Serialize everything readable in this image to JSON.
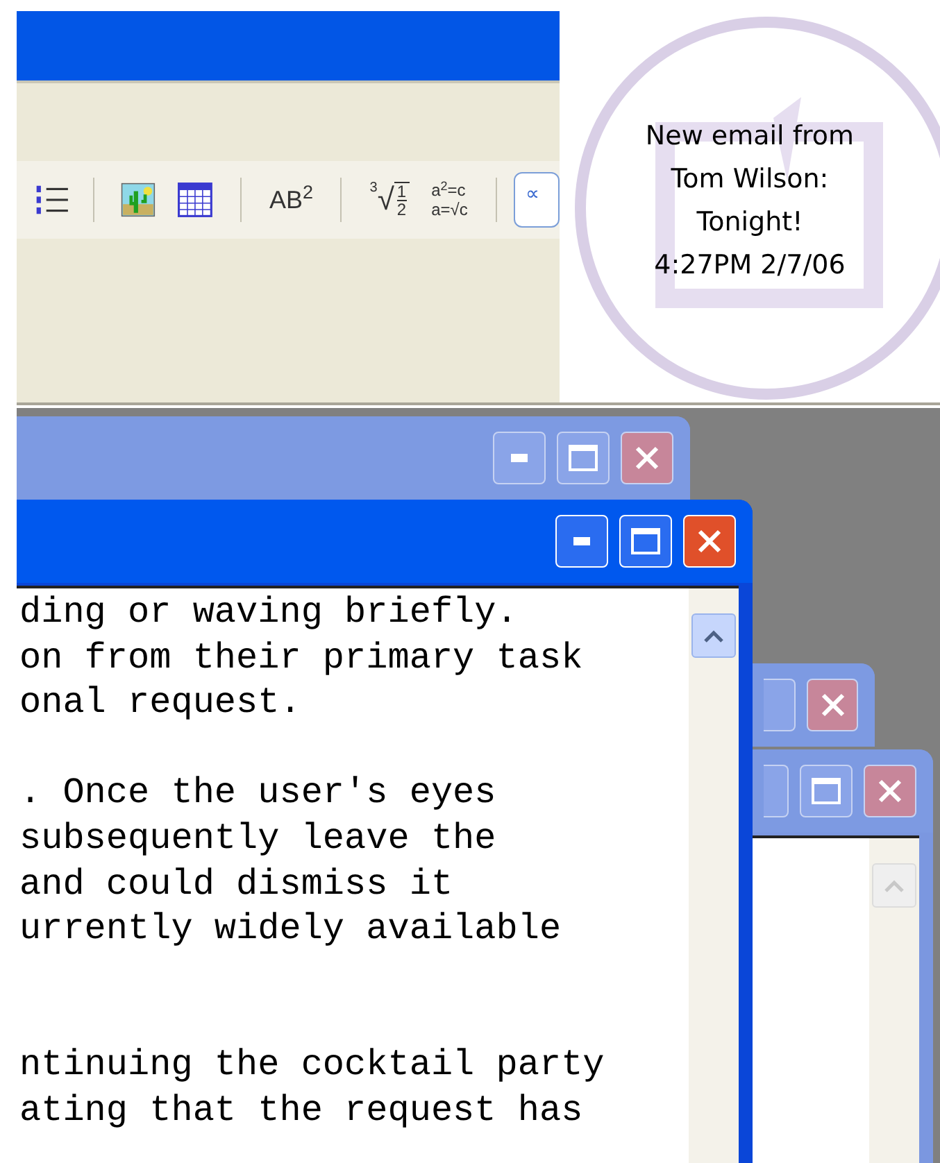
{
  "toolbar": [
    {
      "kind": "numbered-list"
    },
    {
      "kind": "separator"
    },
    {
      "kind": "picture"
    },
    {
      "kind": "table"
    },
    {
      "kind": "separator"
    },
    {
      "kind": "superscript",
      "label": "AB$^{2}$"
    },
    {
      "kind": "separator"
    },
    {
      "kind": "radical",
      "index": "3",
      "sign": "√",
      "numerator": "1",
      "denominator": "2"
    },
    {
      "kind": "formula",
      "top": "a$^{2}$=c",
      "bottom": "a=√c"
    },
    {
      "kind": "separator"
    },
    {
      "kind": "symbol",
      "label": "∝"
    }
  ],
  "notification": {
    "lines": [
      "New email from",
      "Tom Wilson:",
      "Tonight!",
      "4:27PM 2/7/06"
    ]
  },
  "windows": [
    {
      "active": false
    },
    {
      "active": true,
      "text": "ding or waving briefly.\non from their primary task\nonal request.\n\n. Once the user's eyes\nsubsequently leave the\nand could dismiss it\nurrently widely available\n\n\nntinuing the cocktail party\nating that the request has"
    },
    {
      "active": false
    },
    {
      "active": false
    }
  ]
}
